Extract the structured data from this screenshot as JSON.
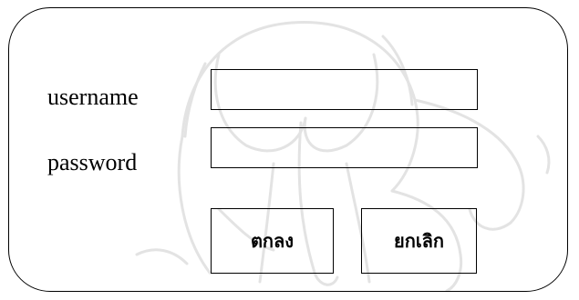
{
  "form": {
    "username_label": "username",
    "password_label": "password",
    "username_value": "",
    "password_value": ""
  },
  "buttons": {
    "ok_label": "ตกลง",
    "cancel_label": "ยกเลิก"
  },
  "colors": {
    "border": "#000000",
    "background": "#ffffff",
    "watermark": "#e6e6e6"
  }
}
